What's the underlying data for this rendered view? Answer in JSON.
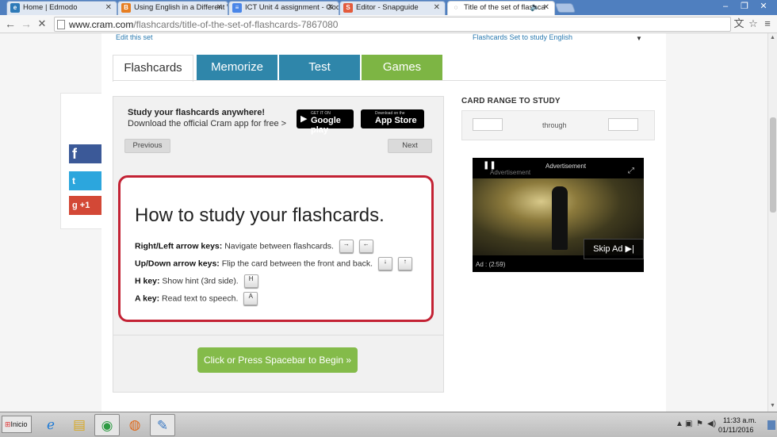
{
  "browser": {
    "tabs": [
      {
        "title": "Home | Edmodo",
        "icon_color": "#2e7ab8",
        "icon": "edmodo-icon"
      },
      {
        "title": "Using English in a Different W",
        "icon_color": "#e67e22",
        "icon": "blogger-icon"
      },
      {
        "title": "ICT Unit 4 assignment - Goo",
        "icon_color": "#4a86e8",
        "icon": "docs-icon"
      },
      {
        "title": "Editor - Snapguide",
        "icon_color": "#e35b3c",
        "icon": "snapguide-icon"
      },
      {
        "title": "Title of the set of flashca",
        "icon_color": "#555555",
        "icon": "loading-icon",
        "active": true
      }
    ],
    "url_host": "www.cram.com",
    "url_path": "/flashcards/title-of-the-set-of-flashcards-7867080"
  },
  "page": {
    "top_left_link": "Edit this set",
    "top_right_link": "Flashcards Set to study English",
    "tabs": [
      "Flashcards",
      "Memorize",
      "Test",
      "Games"
    ],
    "promo": {
      "title": "Study your flashcards anywhere!",
      "subtitle": "Download the official Cram app for free >",
      "google_small": "GET IT ON",
      "google_big": "Google play",
      "apple_small": "Download on the",
      "apple_big": "App Store"
    },
    "prev_label": "Previous",
    "next_label": "Next",
    "card": {
      "heading": "How to study your flashcards.",
      "instructions": [
        {
          "key": "Right/Left arrow keys:",
          "text": " Navigate between flashcards.",
          "keys": [
            "→",
            "←"
          ]
        },
        {
          "key": "Up/Down arrow keys:",
          "text": " Flip the card between the front and back.",
          "keys": [
            "↓",
            "↑"
          ]
        },
        {
          "key": "H key:",
          "text": " Show hint (3rd side).",
          "keys": [
            "H"
          ]
        },
        {
          "key": "A key:",
          "text": " Read text to speech.",
          "keys": [
            "A"
          ]
        }
      ]
    },
    "begin_label": "Click or Press Spacebar to Begin »",
    "range": {
      "title": "CARD RANGE TO STUDY",
      "through": "through",
      "from_value": "",
      "to_value": ""
    },
    "ad": {
      "label": "Advertisement",
      "label_faint": "Advertisement",
      "skip": "Skip Ad ▶|",
      "time": "Ad : (2:59)"
    },
    "social": {
      "fb": "f",
      "tw": "t",
      "gp": "g  +1"
    }
  },
  "taskbar": {
    "start": "Inicio",
    "time": "11:33 a.m.",
    "date": "01/11/2016"
  },
  "colors": {
    "tab_blue": "#2f86aa",
    "tab_green": "#7db544",
    "card_border": "#c32234",
    "begin_green": "#84bb4a"
  }
}
